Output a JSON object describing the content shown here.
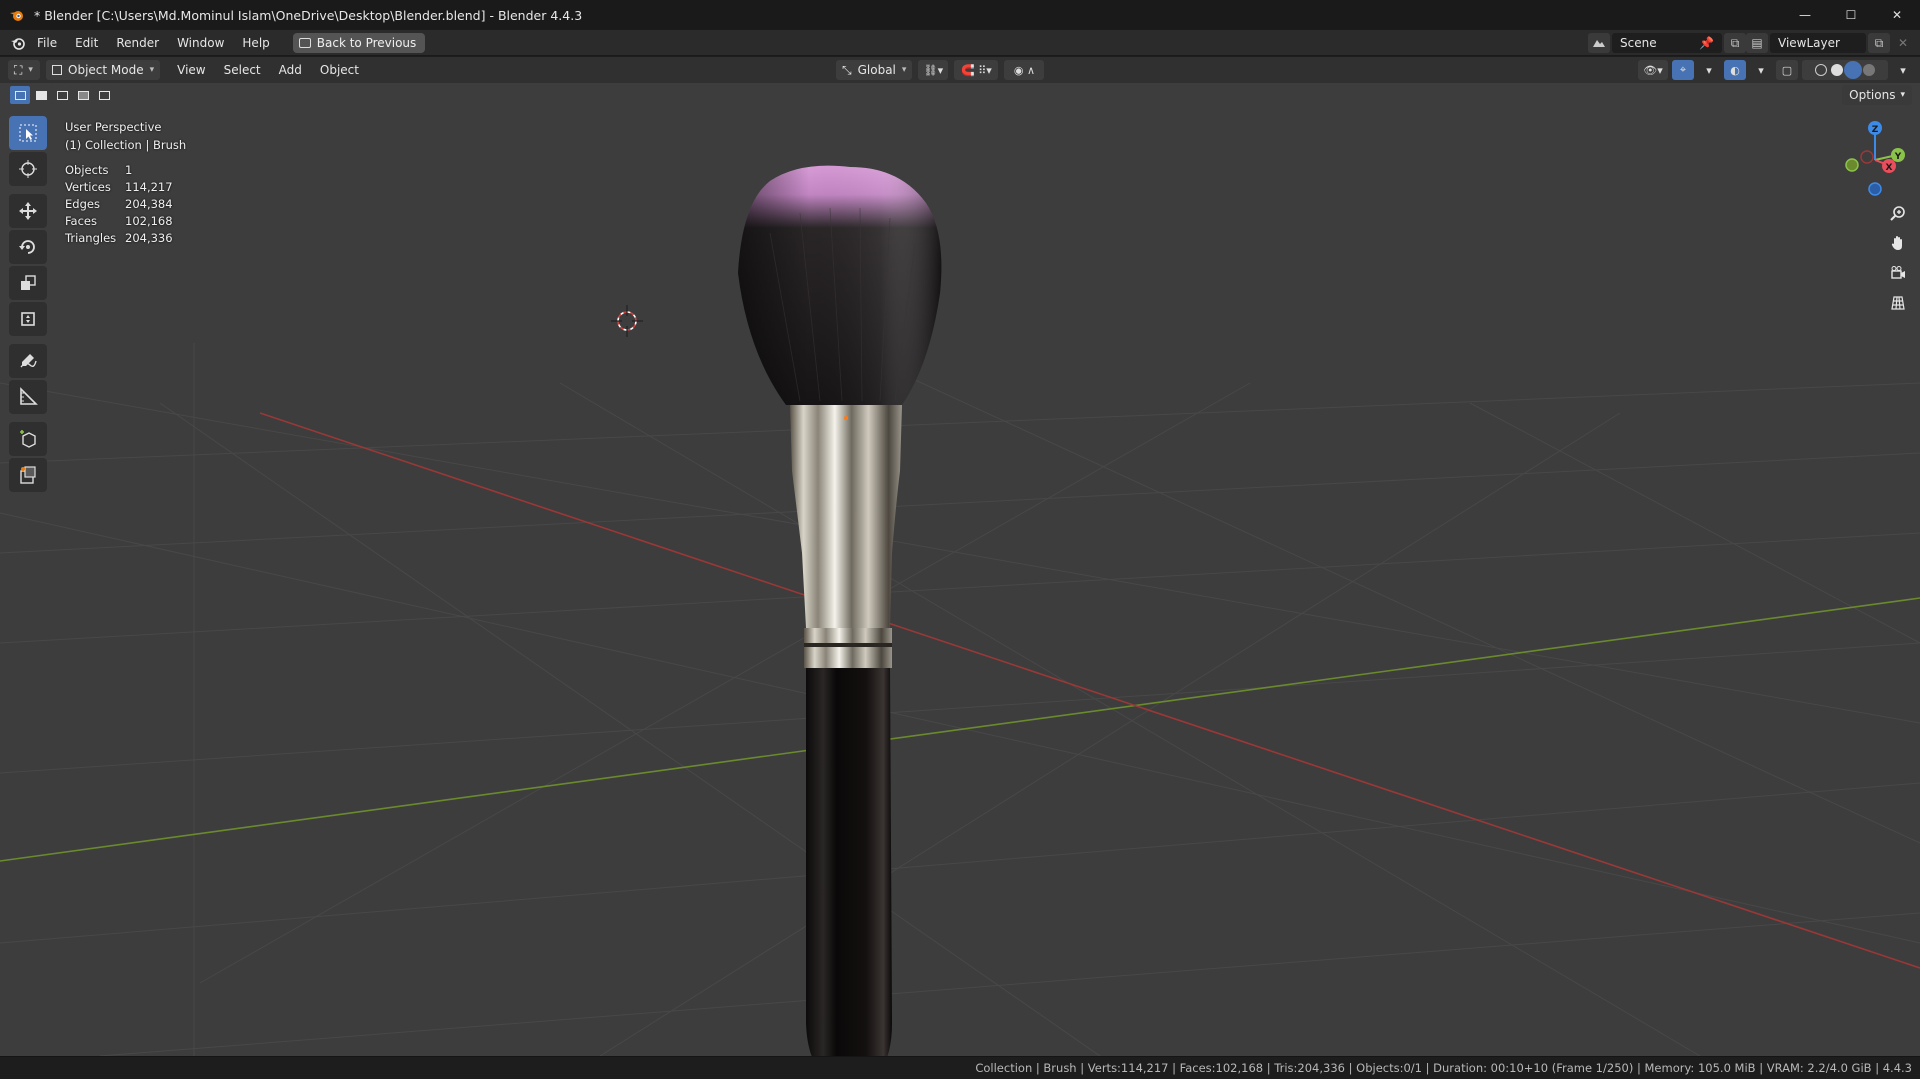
{
  "window": {
    "title": "* Blender [C:\\Users\\Md.Mominul Islam\\OneDrive\\Desktop\\Blender.blend] - Blender 4.4.3",
    "controls": [
      "—",
      "☐",
      "✕"
    ]
  },
  "menubar": {
    "items": [
      "File",
      "Edit",
      "Render",
      "Window",
      "Help"
    ],
    "back_button": "Back to Previous",
    "scene_field": "Scene",
    "viewlayer_field": "ViewLayer"
  },
  "viewport_header": {
    "mode": "Object Mode",
    "menus": [
      "View",
      "Select",
      "Add",
      "Object"
    ],
    "transform_orientation": "Global",
    "options_label": "Options"
  },
  "overlay": {
    "perspective": "User Perspective",
    "collection": "(1) Collection | Brush"
  },
  "stats": [
    {
      "label": "Objects",
      "value": "1"
    },
    {
      "label": "Vertices",
      "value": "114,217"
    },
    {
      "label": "Edges",
      "value": "204,384"
    },
    {
      "label": "Faces",
      "value": "102,168"
    },
    {
      "label": "Triangles",
      "value": "204,336"
    }
  ],
  "gizmo": {
    "x": "X",
    "y": "Y",
    "z": "Z"
  },
  "statusbar": {
    "text": "Collection | Brush | Verts:114,217 | Faces:102,168 | Tris:204,336 | Objects:0/1 | Duration: 00:10+10 (Frame 1/250) | Memory: 105.0 MiB | VRAM: 2.2/4.0 GiB | 4.4.3"
  },
  "colors": {
    "accent": "#4772b3",
    "x_axis": "#e84e5b",
    "y_axis": "#8bc34a",
    "z_axis": "#3d8be8",
    "bristle_tip": "#c68bc6"
  }
}
